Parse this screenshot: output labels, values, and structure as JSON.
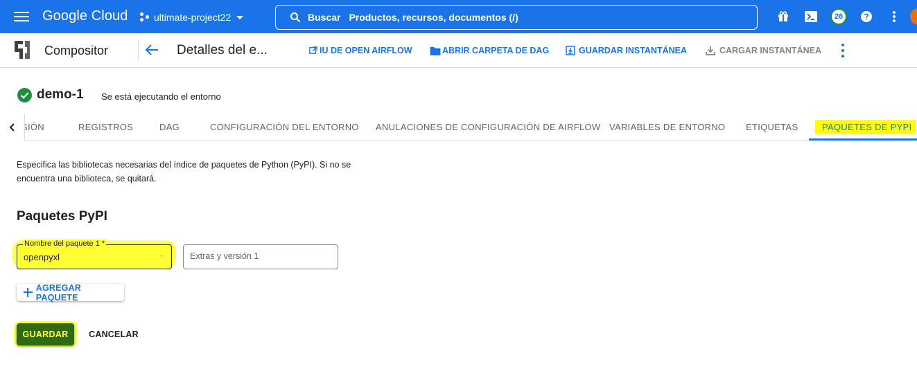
{
  "topbar": {
    "brand": "Google Cloud",
    "project_name": "ultimate-project22",
    "search_label": "Buscar",
    "search_placeholder": "Productos, recursos, documentos (/)",
    "notification_count": "26",
    "accent_color": "#1a73e8",
    "icons": [
      "menu-icon",
      "project-icon",
      "search-icon",
      "gift-icon",
      "cloud-shell-icon",
      "help-icon",
      "more-vert-icon"
    ]
  },
  "subbar": {
    "product_name": "Compositor",
    "page_title": "Detalles del e...",
    "actions": {
      "airflow_ui": "IU DE OPEN AIRFLOW",
      "open_dag_folder": "ABRIR CARPETA DE DAG",
      "save_snapshot": "GUARDAR INSTANTÁNEA",
      "load_snapshot": "CARGAR INSTANTÁNEA"
    }
  },
  "environment": {
    "name": "demo-1",
    "status": "Se está ejecutando el entorno",
    "status_color": "#1e8e3e"
  },
  "tabs": [
    {
      "label": "SIÓN"
    },
    {
      "label": "REGISTROS"
    },
    {
      "label": "DAG"
    },
    {
      "label": "CONFIGURACIÓN DEL ENTORNO"
    },
    {
      "label": "ANULACIONES DE CONFIGURACIÓN DE AIRFLOW"
    },
    {
      "label": "VARIABLES DE ENTORNO"
    },
    {
      "label": "ETIQUETAS"
    },
    {
      "label": "PAQUETES DE PYPI",
      "active": true
    }
  ],
  "main": {
    "description": "Especifica las bibliotecas necesarias del índice de paquetes de Python (PyPI). Si no se encuentra una biblioteca, se quitará.",
    "section_title": "Paquetes PyPI",
    "package_field": {
      "label": "Nombre del paquete 1 *",
      "value": "openpyxl"
    },
    "extras_field": {
      "placeholder": "Extras y versión 1",
      "value": ""
    },
    "add_package_label": "AGREGAR PAQUETE",
    "save_label": "GUARDAR",
    "cancel_label": "CANCELAR",
    "highlight_color": "#ffff00"
  }
}
